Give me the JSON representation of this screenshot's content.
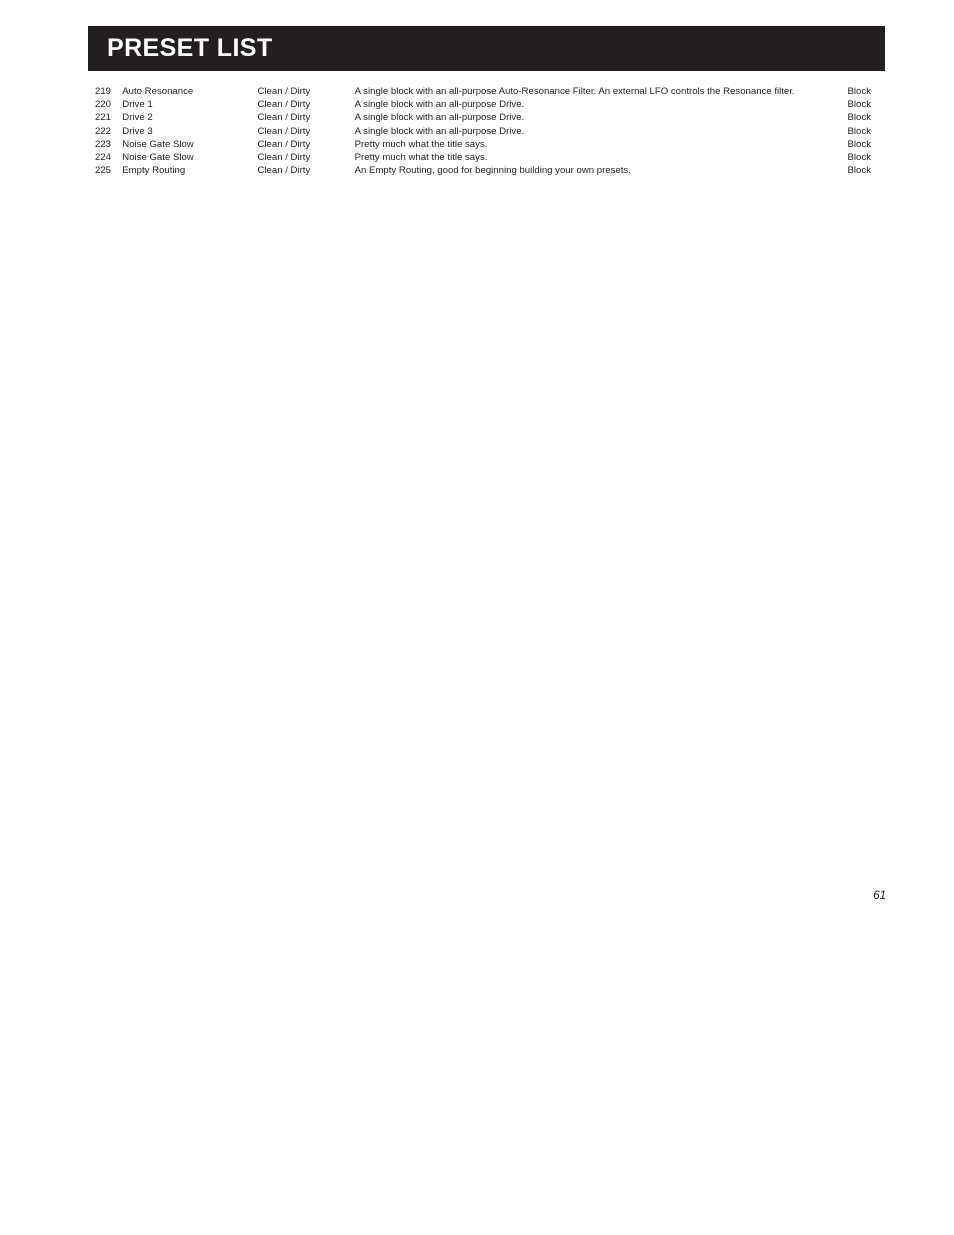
{
  "page": {
    "title": "PRESET LIST",
    "page_number": "61",
    "accent_color": "#231f20",
    "text_color": "#231f20",
    "background_color": "#ffffff"
  },
  "table": {
    "rows": [
      {
        "number": "219",
        "name": "Auto Resonance",
        "type": "Clean / Dirty",
        "description": "A single block with an all-purpose Auto-Resonance Filter. An external LFO controls the Resonance filter.",
        "category": "Block"
      },
      {
        "number": "220",
        "name": "Drive 1",
        "type": "Clean / Dirty",
        "description": "A single block with an all-purpose Drive.",
        "category": "Block"
      },
      {
        "number": "221",
        "name": "Drive 2",
        "type": "Clean / Dirty",
        "description": "A single block with an all-purpose Drive.",
        "category": "Block"
      },
      {
        "number": "222",
        "name": "Drive 3",
        "type": "Clean / Dirty",
        "description": "A single block with an all-purpose Drive.",
        "category": "Block"
      },
      {
        "number": "223",
        "name": "Noise Gate Slow",
        "type": "Clean / Dirty",
        "description": "Pretty much what the title says.",
        "category": "Block"
      },
      {
        "number": "224",
        "name": "Noise Gate Slow",
        "type": "Clean / Dirty",
        "description": "Pretty much what the title says.",
        "category": "Block"
      },
      {
        "number": "225",
        "name": "Empty Routing",
        "type": "Clean / Dirty",
        "description": "An Empty Routing, good for beginning building your own presets.",
        "category": "Block"
      }
    ]
  }
}
